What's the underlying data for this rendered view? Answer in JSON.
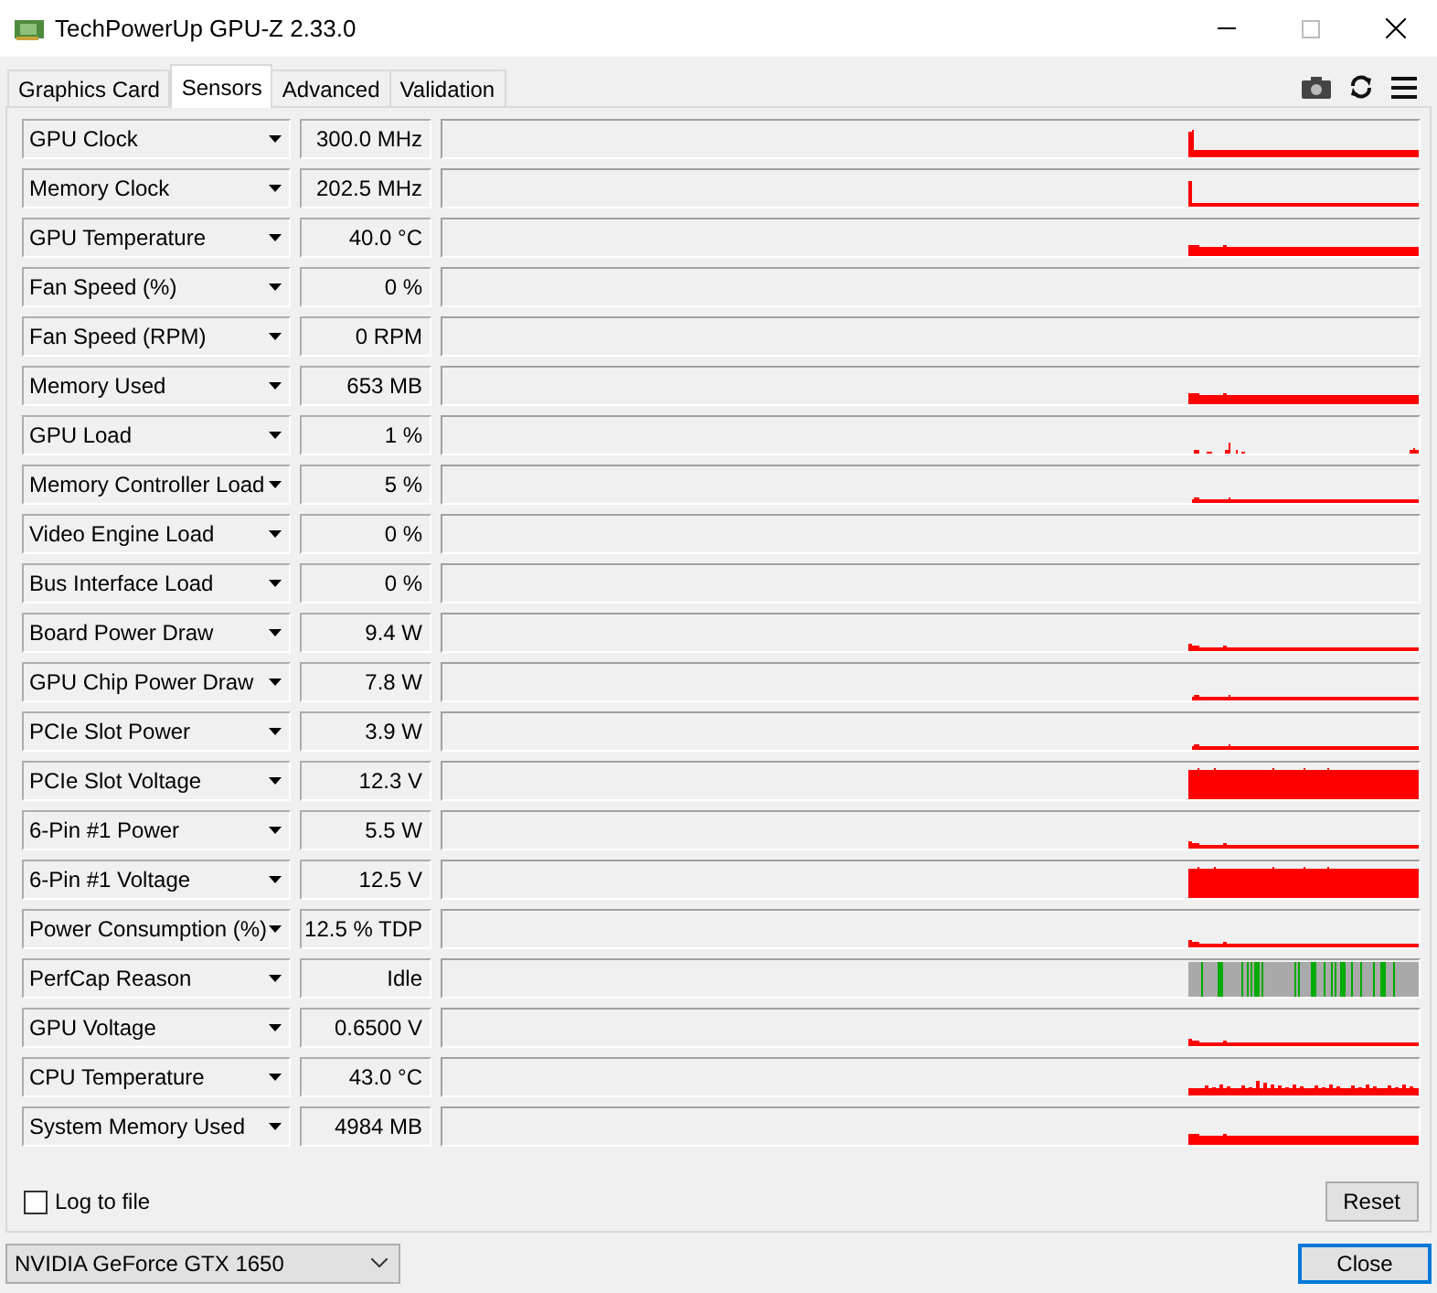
{
  "window": {
    "title": "TechPowerUp GPU-Z 2.33.0"
  },
  "tabs": [
    {
      "label": "Graphics Card",
      "selected": false
    },
    {
      "label": "Sensors",
      "selected": true
    },
    {
      "label": "Advanced",
      "selected": false
    },
    {
      "label": "Validation",
      "selected": false
    }
  ],
  "sensors": [
    {
      "name": "GPU Clock",
      "value": "300.0 MHz",
      "kind": "spike"
    },
    {
      "name": "Memory Clock",
      "value": "202.5 MHz",
      "kind": "spikethin"
    },
    {
      "name": "GPU Temperature",
      "value": "40.0 °C",
      "kind": "band"
    },
    {
      "name": "Fan Speed (%)",
      "value": "0 %",
      "kind": "empty"
    },
    {
      "name": "Fan Speed (RPM)",
      "value": "0 RPM",
      "kind": "empty"
    },
    {
      "name": "Memory Used",
      "value": "653 MB",
      "kind": "band"
    },
    {
      "name": "GPU Load",
      "value": "1 %",
      "kind": "sparse"
    },
    {
      "name": "Memory Controller Load",
      "value": "5 %",
      "kind": "line"
    },
    {
      "name": "Video Engine Load",
      "value": "0 %",
      "kind": "empty"
    },
    {
      "name": "Bus Interface Load",
      "value": "0 %",
      "kind": "empty"
    },
    {
      "name": "Board Power Draw",
      "value": "9.4 W",
      "kind": "low"
    },
    {
      "name": "GPU Chip Power Draw",
      "value": "7.8 W",
      "kind": "line"
    },
    {
      "name": "PCIe Slot Power",
      "value": "3.9 W",
      "kind": "line"
    },
    {
      "name": "PCIe Slot Voltage",
      "value": "12.3 V",
      "kind": "full"
    },
    {
      "name": "6-Pin #1 Power",
      "value": "5.5 W",
      "kind": "low"
    },
    {
      "name": "6-Pin #1 Voltage",
      "value": "12.5 V",
      "kind": "full"
    },
    {
      "name": "Power Consumption (%)",
      "value": "12.5 % TDP",
      "kind": "low"
    },
    {
      "name": "PerfCap Reason",
      "value": "Idle",
      "kind": "perfcap"
    },
    {
      "name": "GPU Voltage",
      "value": "0.6500 V",
      "kind": "low"
    },
    {
      "name": "CPU Temperature",
      "value": "43.0 °C",
      "kind": "noise"
    },
    {
      "name": "System Memory Used",
      "value": "4984 MB",
      "kind": "band"
    }
  ],
  "log_to_file": {
    "label": "Log to file",
    "checked": false
  },
  "reset_button": "Reset",
  "gpu_select": {
    "value": "NVIDIA GeForce GTX 1650"
  },
  "close_button": "Close"
}
